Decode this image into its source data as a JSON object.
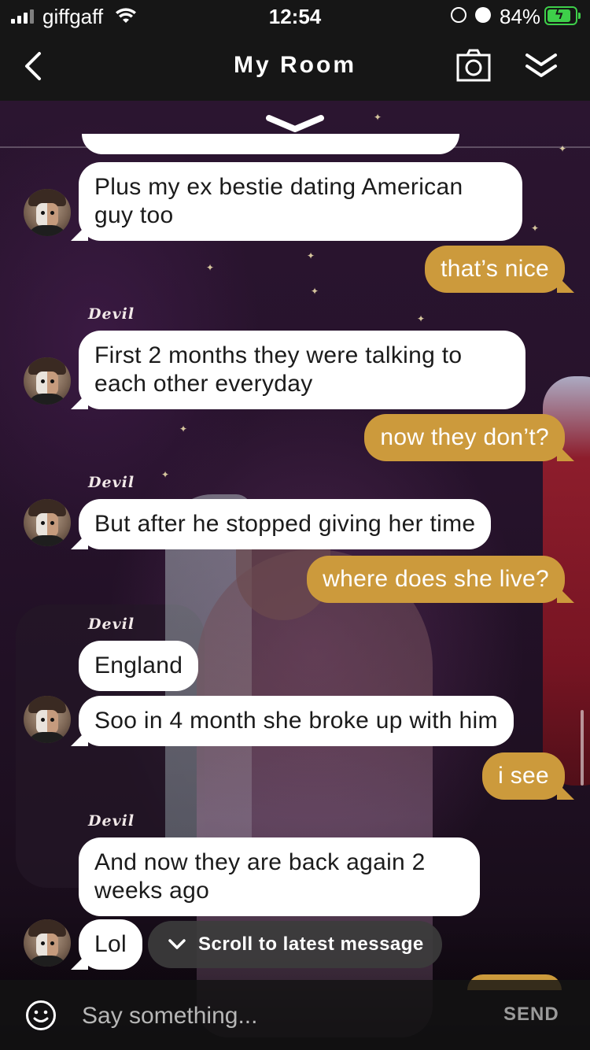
{
  "status_bar": {
    "carrier": "giffgaff",
    "time": "12:54",
    "battery_percent": "84%",
    "battery_level": 0.84,
    "icons": [
      "signal-icon",
      "wifi-icon",
      "orientation-lock-icon",
      "alarm-icon",
      "battery-charging-icon"
    ]
  },
  "header": {
    "title": "My Room",
    "icons": [
      "back-chevron-icon",
      "camera-icon",
      "collapse-double-chevron-icon"
    ]
  },
  "chat": {
    "messages": [
      {
        "side": "in",
        "avatar": true,
        "text": "Plus my ex bestie dating American guy too"
      },
      {
        "side": "out",
        "text": "that’s nice"
      },
      {
        "side": "in",
        "sender": "Devil",
        "avatar": true,
        "text": "First 2 months they were talking to each other everyday"
      },
      {
        "side": "out",
        "text": "now they don’t?"
      },
      {
        "side": "in",
        "sender": "Devil",
        "avatar": true,
        "text": "But after he stopped giving her time"
      },
      {
        "side": "out",
        "text": "where does she live?"
      },
      {
        "side": "in",
        "sender": "Devil",
        "avatar": false,
        "text": "England"
      },
      {
        "side": "in",
        "avatar": true,
        "text": "Soo in 4 month she broke up with him"
      },
      {
        "side": "out",
        "text": "i see"
      },
      {
        "side": "in",
        "sender": "Devil",
        "avatar": false,
        "text": "And now they are back again 2 weeks ago"
      },
      {
        "side": "in",
        "avatar": true,
        "text": "Lol"
      }
    ],
    "scroll_pill": "Scroll to latest message"
  },
  "input": {
    "placeholder": "Say something...",
    "send_label": "SEND",
    "emoji_icon": "smiley-icon"
  },
  "colors": {
    "outgoing_bubble": "#cc9a3c",
    "incoming_bubble": "#ffffff",
    "header_bg": "#161616",
    "battery": "#3ecf4a"
  }
}
